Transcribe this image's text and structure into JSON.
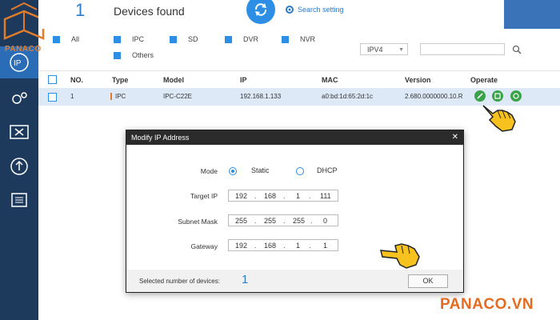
{
  "header": {
    "count": "1",
    "title": "Devices found",
    "search_setting": "Search setting"
  },
  "logo": {
    "text": "PANACO"
  },
  "filters": {
    "items": [
      "All",
      "IPC",
      "SD",
      "DVR",
      "NVR",
      "Others"
    ],
    "protocol": "IPV4",
    "search_placeholder": ""
  },
  "table": {
    "columns": [
      "NO.",
      "Type",
      "Model",
      "IP",
      "MAC",
      "Version",
      "Operate"
    ],
    "rows": [
      {
        "no": "1",
        "type": "IPC",
        "model": "IPC-C22E",
        "ip": "192.168.1.133",
        "mac": "a0:bd:1d:65:2d:1c",
        "version": "2.680.0000000.10.R"
      }
    ]
  },
  "dialog": {
    "title": "Modify IP Address",
    "mode_label": "Mode",
    "mode_static": "Static",
    "mode_dhcp": "DHCP",
    "target_ip_label": "Target IP",
    "target_ip": [
      "192",
      "168",
      "1",
      "111"
    ],
    "subnet_label": "Subnet Mask",
    "subnet": [
      "255",
      "255",
      "255",
      "0"
    ],
    "gateway_label": "Gateway",
    "gateway": [
      "192",
      "168",
      "1",
      "1"
    ],
    "selected_label": "Selected number of devices:",
    "selected_count": "1",
    "ok_label": "OK"
  },
  "brand": "PANACO.VN",
  "colors": {
    "sidebar": "#1d3a5c",
    "accent": "#2d8ee6",
    "brand": "#e56b1f",
    "operate_icon": "#3aa34a"
  }
}
